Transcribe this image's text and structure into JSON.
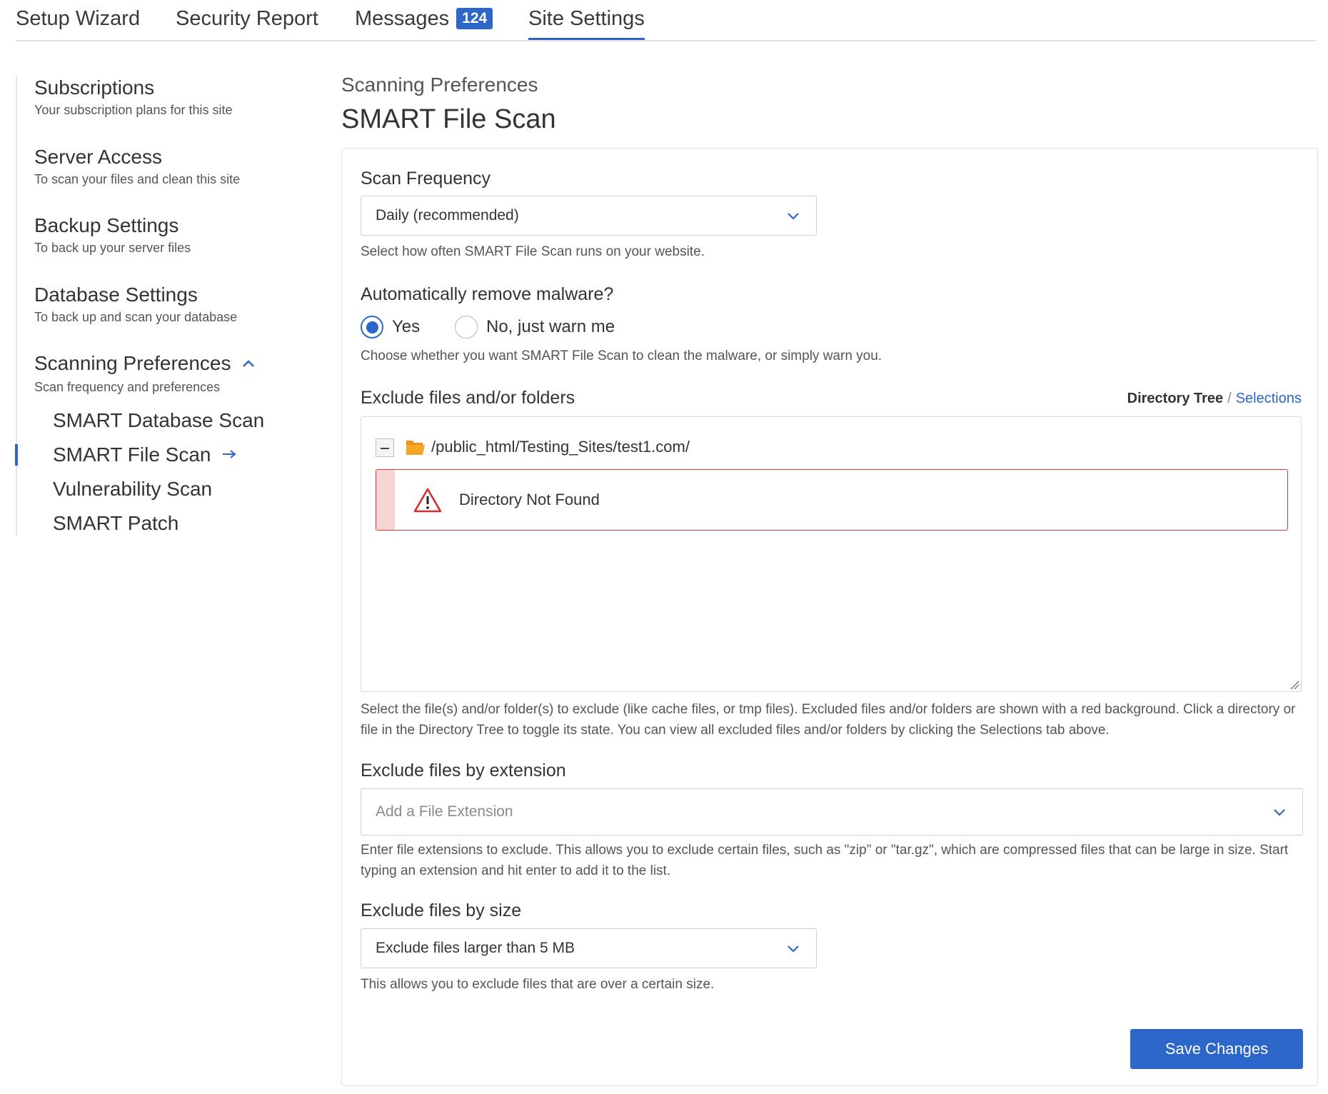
{
  "tabs": [
    {
      "label": "Setup Wizard"
    },
    {
      "label": "Security Report"
    },
    {
      "label": "Messages",
      "badge": "124"
    },
    {
      "label": "Site Settings",
      "active": true
    }
  ],
  "sidebar": {
    "items": [
      {
        "title": "Subscriptions",
        "subtitle": "Your subscription plans for this site"
      },
      {
        "title": "Server Access",
        "subtitle": "To scan your files and clean this site"
      },
      {
        "title": "Backup Settings",
        "subtitle": "To back up your server files"
      },
      {
        "title": "Database Settings",
        "subtitle": "To back up and scan your database"
      },
      {
        "title": "Scanning Preferences",
        "subtitle": "Scan frequency and preferences",
        "expanded": true
      }
    ],
    "children": [
      {
        "label": "SMART Database Scan"
      },
      {
        "label": "SMART File Scan",
        "active": true
      },
      {
        "label": "Vulnerability Scan"
      },
      {
        "label": "SMART Patch"
      }
    ]
  },
  "main": {
    "breadcrumb": "Scanning Preferences",
    "title": "SMART File Scan",
    "scan_frequency": {
      "label": "Scan Frequency",
      "value": "Daily (recommended)",
      "help": "Select how often SMART File Scan runs on your website."
    },
    "auto_remove": {
      "label": "Automatically remove malware?",
      "options": [
        {
          "label": "Yes",
          "checked": true
        },
        {
          "label": "No, just warn me",
          "checked": false
        }
      ],
      "help": "Choose whether you want SMART File Scan to clean the malware, or simply warn you."
    },
    "exclude_folders": {
      "label": "Exclude files and/or folders",
      "view_active": "Directory Tree",
      "separator": "/",
      "view_other": "Selections",
      "tree_path": "/public_html/Testing_Sites/test1.com/",
      "alert": "Directory Not Found",
      "help": "Select the file(s) and/or folder(s) to exclude (like cache files, or tmp files). Excluded files and/or folders are shown with a red background. Click a directory or file in the Directory Tree to toggle its state. You can view all excluded files and/or folders by clicking the Selections tab above."
    },
    "exclude_extension": {
      "label": "Exclude files by extension",
      "placeholder": "Add a File Extension",
      "help": "Enter file extensions to exclude. This allows you to exclude certain files, such as \"zip\" or \"tar.gz\", which are compressed files that can be large in size. Start typing an extension and hit enter to add it to the list."
    },
    "exclude_size": {
      "label": "Exclude files by size",
      "value": "Exclude files larger than 5 MB",
      "help": "This allows you to exclude files that are over a certain size."
    },
    "save_label": "Save Changes"
  },
  "colors": {
    "accent": "#2c66c8",
    "alert_border": "#d93a3a",
    "alert_stripe": "#f8d3d3",
    "folder": "#f5a623"
  }
}
